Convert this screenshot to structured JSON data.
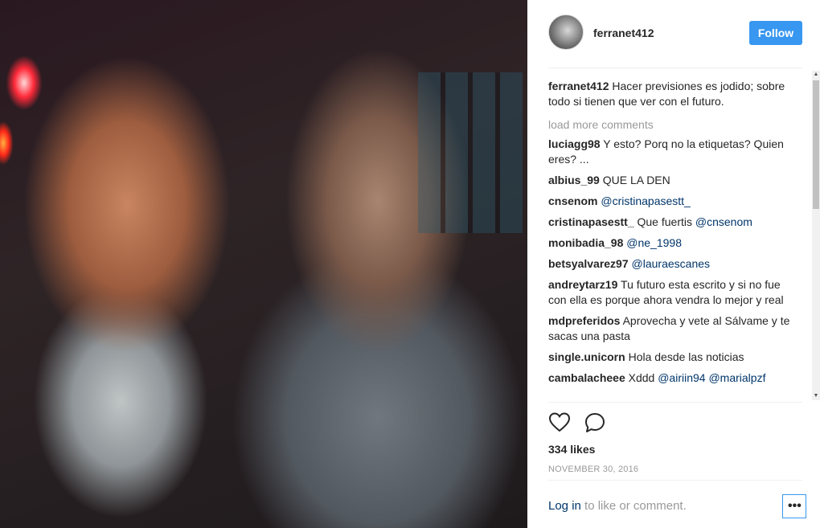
{
  "post": {
    "author": "ferranet412",
    "follow_label": "Follow",
    "caption_user": "ferranet412",
    "caption_text": "Hacer previsiones es jodido; sobre todo si tienen que ver con el futuro.",
    "load_more": "load more comments",
    "comments": [
      {
        "user": "luciagg98",
        "text": "Y esto? Porq no la etiquetas? Quien eres? ...",
        "mention": ""
      },
      {
        "user": "albius_99",
        "text": "QUE LA DEN",
        "mention": ""
      },
      {
        "user": "cnsenom",
        "text": "",
        "mention": "@cristinapasestt_"
      },
      {
        "user": "cristinapasestt_",
        "text": "Que fuertis ",
        "mention": "@cnsenom"
      },
      {
        "user": "monibadia_98",
        "text": "",
        "mention": "@ne_1998"
      },
      {
        "user": "betsyalvarez97",
        "text": "",
        "mention": "@lauraescanes"
      },
      {
        "user": "andreytarz19",
        "text": "Tu futuro esta escrito y si no fue con ella es porque ahora vendra lo mejor y real",
        "mention": ""
      },
      {
        "user": "mdpreferidos",
        "text": "Aprovecha y vete al Sálvame y te sacas una pasta",
        "mention": ""
      },
      {
        "user": "single.unicorn",
        "text": "Hola desde las noticias",
        "mention": ""
      },
      {
        "user": "cambalacheee",
        "text": "Xddd ",
        "mention": "@airiin94 @marialpzf"
      }
    ],
    "likes": "334 likes",
    "date": "NOVEMBER 30, 2016",
    "login_link": "Log in",
    "login_rest": " to like or comment.",
    "more_label": "•••"
  },
  "icons": {
    "like": "heart-icon",
    "comment": "comment-bubble-icon",
    "scroll_up": "arrow-up-icon",
    "scroll_down": "arrow-down-icon"
  }
}
